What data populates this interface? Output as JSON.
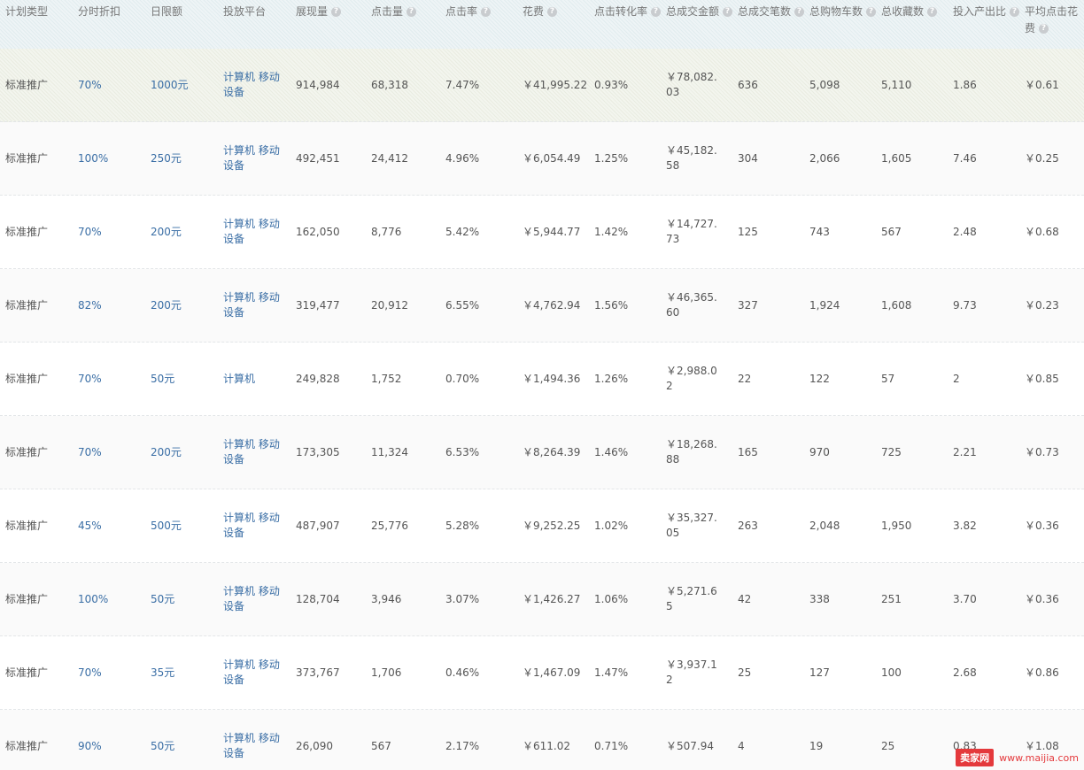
{
  "columns": [
    {
      "label": "计划类型",
      "help": false
    },
    {
      "label": "分时折扣",
      "help": false
    },
    {
      "label": "日限额",
      "help": false
    },
    {
      "label": "投放平台",
      "help": false
    },
    {
      "label": "展现量",
      "help": true
    },
    {
      "label": "点击量",
      "help": true
    },
    {
      "label": "点击率",
      "help": true
    },
    {
      "label": "花费",
      "help": true
    },
    {
      "label": "点击转化率",
      "help": true
    },
    {
      "label": "总成交金额",
      "help": true
    },
    {
      "label": "总成交笔数",
      "help": true
    },
    {
      "label": "总购物车数",
      "help": true
    },
    {
      "label": "总收藏数",
      "help": true
    },
    {
      "label": "投入产出比",
      "help": true
    },
    {
      "label": "平均点击花费",
      "help": true
    }
  ],
  "help_icon_glyph": "?",
  "rows": [
    [
      "标准推广",
      "70%",
      "1000元",
      "计算机 移动设备",
      "914,984",
      "68,318",
      "7.47%",
      "￥41,995.22",
      "0.93%",
      "￥78,082.03",
      "636",
      "5,098",
      "5,110",
      "1.86",
      "￥0.61"
    ],
    [
      "标准推广",
      "100%",
      "250元",
      "计算机 移动设备",
      "492,451",
      "24,412",
      "4.96%",
      "￥6,054.49",
      "1.25%",
      "￥45,182.58",
      "304",
      "2,066",
      "1,605",
      "7.46",
      "￥0.25"
    ],
    [
      "标准推广",
      "70%",
      "200元",
      "计算机 移动设备",
      "162,050",
      "8,776",
      "5.42%",
      "￥5,944.77",
      "1.42%",
      "￥14,727.73",
      "125",
      "743",
      "567",
      "2.48",
      "￥0.68"
    ],
    [
      "标准推广",
      "82%",
      "200元",
      "计算机 移动设备",
      "319,477",
      "20,912",
      "6.55%",
      "￥4,762.94",
      "1.56%",
      "￥46,365.60",
      "327",
      "1,924",
      "1,608",
      "9.73",
      "￥0.23"
    ],
    [
      "标准推广",
      "70%",
      "50元",
      "计算机",
      "249,828",
      "1,752",
      "0.70%",
      "￥1,494.36",
      "1.26%",
      "￥2,988.02",
      "22",
      "122",
      "57",
      "2",
      "￥0.85"
    ],
    [
      "标准推广",
      "70%",
      "200元",
      "计算机 移动设备",
      "173,305",
      "11,324",
      "6.53%",
      "￥8,264.39",
      "1.46%",
      "￥18,268.88",
      "165",
      "970",
      "725",
      "2.21",
      "￥0.73"
    ],
    [
      "标准推广",
      "45%",
      "500元",
      "计算机 移动设备",
      "487,907",
      "25,776",
      "5.28%",
      "￥9,252.25",
      "1.02%",
      "￥35,327.05",
      "263",
      "2,048",
      "1,950",
      "3.82",
      "￥0.36"
    ],
    [
      "标准推广",
      "100%",
      "50元",
      "计算机 移动设备",
      "128,704",
      "3,946",
      "3.07%",
      "￥1,426.27",
      "1.06%",
      "￥5,271.65",
      "42",
      "338",
      "251",
      "3.70",
      "￥0.36"
    ],
    [
      "标准推广",
      "70%",
      "35元",
      "计算机 移动设备",
      "373,767",
      "1,706",
      "0.46%",
      "￥1,467.09",
      "1.47%",
      "￥3,937.12",
      "25",
      "127",
      "100",
      "2.68",
      "￥0.86"
    ],
    [
      "标准推广",
      "90%",
      "50元",
      "计算机 移动设备",
      "26,090",
      "567",
      "2.17%",
      "￥611.02",
      "0.71%",
      "￥507.94",
      "4",
      "19",
      "25",
      "0.83",
      "￥1.08"
    ]
  ],
  "link_columns": [
    1,
    2,
    3
  ],
  "colors": {
    "link": "#3a6ea5",
    "text": "#555555",
    "header_text": "#777777"
  },
  "watermark": {
    "logo": "卖家网",
    "url": "www.maijia.com"
  }
}
